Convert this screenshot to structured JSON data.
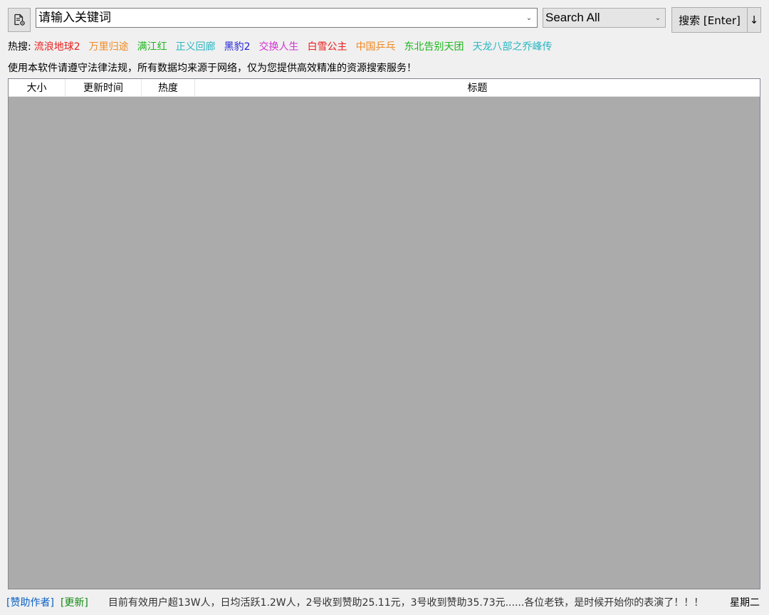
{
  "toolbar": {
    "doc_icon": "document-gear-icon",
    "search_placeholder": "请输入关键词",
    "engine_selected": "Search All",
    "search_button_label": "搜索 [Enter]",
    "down_button_label": "↓"
  },
  "hot_search": {
    "label": "热搜:",
    "items": [
      {
        "text": "流浪地球2",
        "color": "#e8201e"
      },
      {
        "text": "万里归途",
        "color": "#f08a24"
      },
      {
        "text": "满江红",
        "color": "#1fb51f"
      },
      {
        "text": "正义回廊",
        "color": "#27b6c2"
      },
      {
        "text": "黑豹2",
        "color": "#2020d8"
      },
      {
        "text": "交换人生",
        "color": "#d232d2"
      },
      {
        "text": "白雪公主",
        "color": "#e8201e"
      },
      {
        "text": "中国乒乓",
        "color": "#f08a24"
      },
      {
        "text": "东北告别天团",
        "color": "#1fb51f"
      },
      {
        "text": "天龙八部之乔峰传",
        "color": "#27b6c2"
      }
    ]
  },
  "notice": "使用本软件请遵守法律法规，所有数据均来源于网络，仅为您提供高效精准的资源搜索服务！",
  "results": {
    "columns": [
      "大小",
      "更新时间",
      "热度",
      "标题"
    ],
    "rows": []
  },
  "status_bar": {
    "sponsor_link": "[赞助作者]",
    "update_link": "[更新]",
    "message": "目前有效用户超13W人，日均活跃1.2W人，2号收到赞助25.11元，3号收到赞助35.73元......各位老铁，是时候开始你的表演了！！！",
    "weekday": "星期二"
  }
}
